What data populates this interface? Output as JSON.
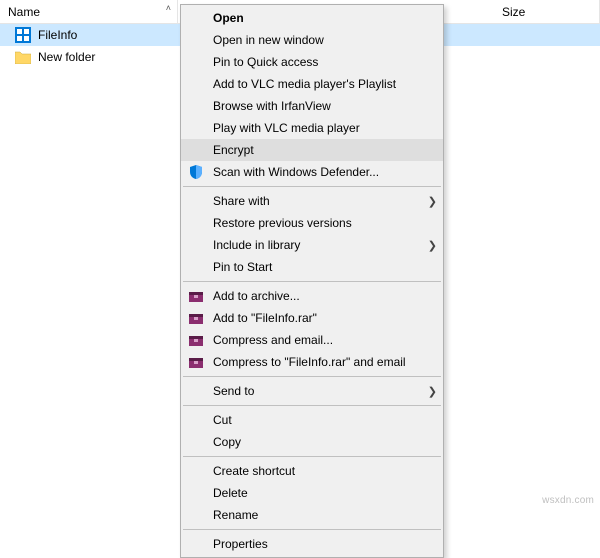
{
  "columns": {
    "name": "Name",
    "size": "Size"
  },
  "rows": [
    {
      "label": "FileInfo"
    },
    {
      "label": "New folder"
    }
  ],
  "menu": {
    "open": "Open",
    "open_new_window": "Open in new window",
    "pin_quick_access": "Pin to Quick access",
    "add_vlc_playlist": "Add to VLC media player's Playlist",
    "browse_irfanview": "Browse with IrfanView",
    "play_vlc": "Play with VLC media player",
    "encrypt": "Encrypt",
    "scan_defender": "Scan with Windows Defender...",
    "share_with": "Share with",
    "restore_previous": "Restore previous versions",
    "include_library": "Include in library",
    "pin_start": "Pin to Start",
    "add_archive": "Add to archive...",
    "add_rar": "Add to \"FileInfo.rar\"",
    "compress_email": "Compress and email...",
    "compress_rar_email": "Compress to \"FileInfo.rar\" and email",
    "send_to": "Send to",
    "cut": "Cut",
    "copy": "Copy",
    "create_shortcut": "Create shortcut",
    "delete": "Delete",
    "rename": "Rename",
    "properties": "Properties"
  },
  "watermark": "wsxdn.com"
}
